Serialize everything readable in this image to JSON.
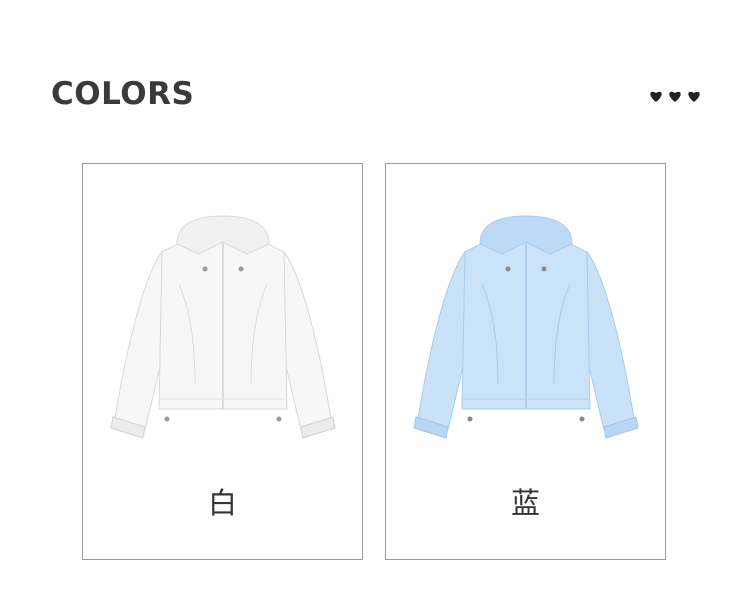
{
  "header": {
    "title": "COLORS",
    "decoration_icon": "three-hearts-icon"
  },
  "colors": [
    {
      "label": "白",
      "fill": "#f7f7f7",
      "shade": "#e2e2e2"
    },
    {
      "label": "蓝",
      "fill": "#c9e2f8",
      "shade": "#a9cbeb"
    }
  ]
}
